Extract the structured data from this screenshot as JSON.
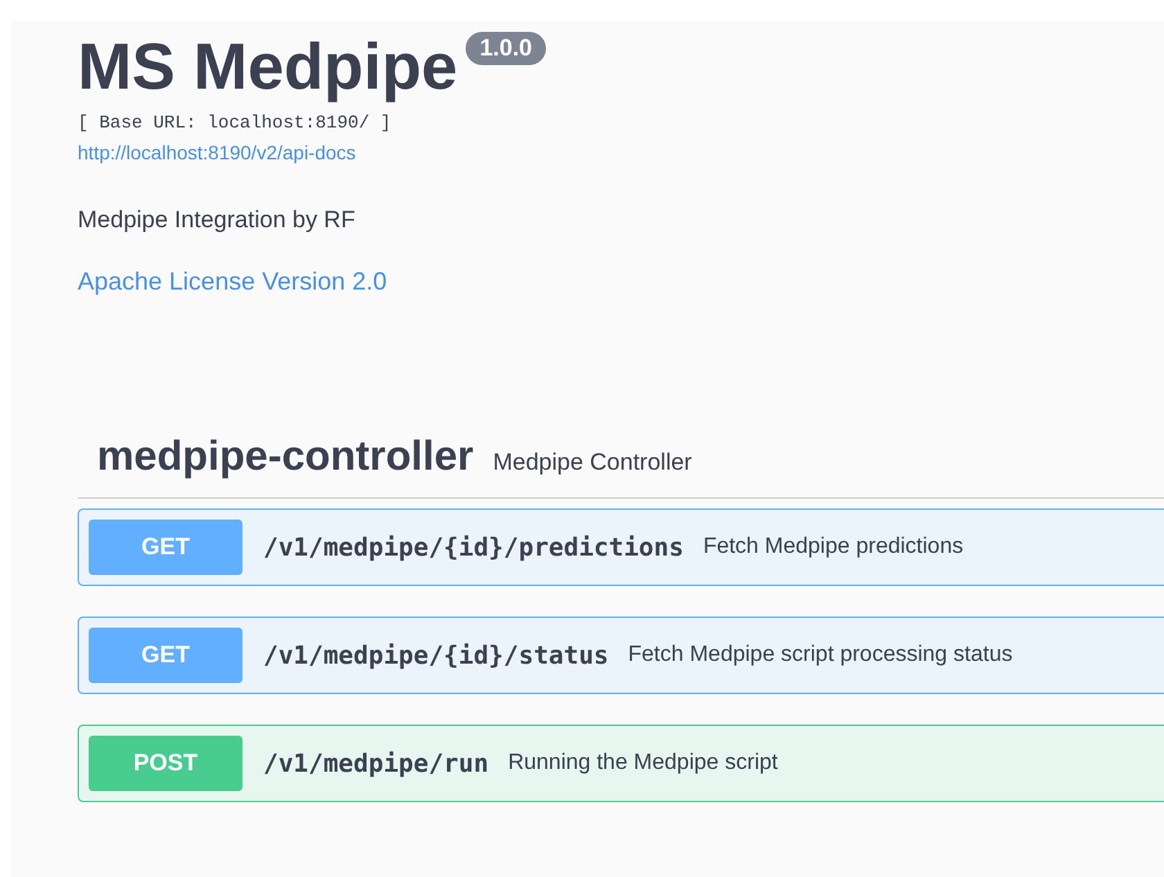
{
  "info": {
    "title": "MS Medpipe",
    "version": "1.0.0",
    "base_url": "[ Base URL: localhost:8190/ ]",
    "spec_link": "http://localhost:8190/v2/api-docs",
    "description": "Medpipe Integration by RF",
    "license": "Apache License Version 2.0"
  },
  "tag": {
    "name": "medpipe-controller",
    "description": "Medpipe Controller"
  },
  "operations": [
    {
      "kind": "get",
      "method": "GET",
      "path": "/v1/medpipe/{id}/predictions",
      "summary": "Fetch Medpipe predictions"
    },
    {
      "kind": "get",
      "method": "GET",
      "path": "/v1/medpipe/{id}/status",
      "summary": "Fetch Medpipe script processing status"
    },
    {
      "kind": "post",
      "method": "POST",
      "path": "/v1/medpipe/run",
      "summary": "Running the Medpipe script"
    }
  ]
}
